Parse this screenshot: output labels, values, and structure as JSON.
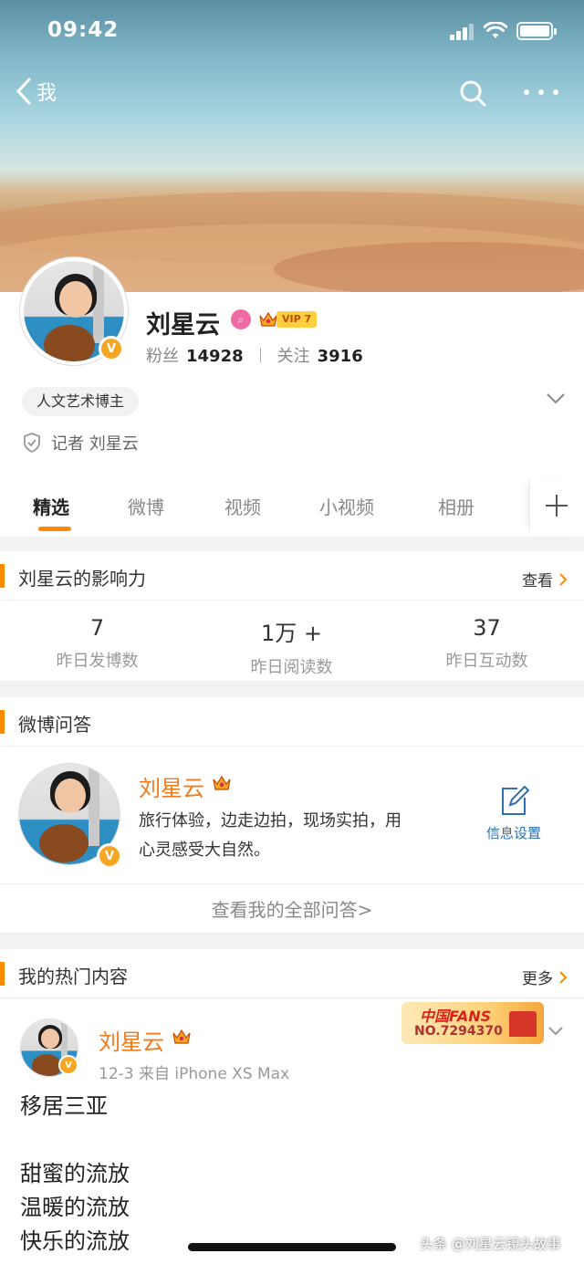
{
  "status_bar": {
    "time": "09:42"
  },
  "nav": {
    "back_label": "我"
  },
  "profile": {
    "name": "刘星云",
    "vip_label": "VIP 7",
    "verified_glyph": "V",
    "followers_label": "粉丝",
    "followers_count": "14928",
    "following_label": "关注",
    "following_count": "3916",
    "tag": "人文艺术博主",
    "reporter": "记者 刘星云"
  },
  "tabs": [
    {
      "label": "精选"
    },
    {
      "label": "微博"
    },
    {
      "label": "视频"
    },
    {
      "label": "小视频"
    },
    {
      "label": "相册"
    }
  ],
  "influence": {
    "title": "刘星云的影响力",
    "more_label": "查看",
    "metrics": [
      {
        "value": "7",
        "label": "昨日发博数"
      },
      {
        "value": "1万 +",
        "label": "昨日阅读数"
      },
      {
        "value": "37",
        "label": "昨日互动数"
      }
    ]
  },
  "qa": {
    "title": "微博问答",
    "name": "刘星云",
    "description": "旅行体验，边走边拍，现场实拍，用心灵感受大自然。",
    "settings_label": "信息设置",
    "view_all": "查看我的全部问答>"
  },
  "hot": {
    "title": "我的热门内容",
    "more_label": "更多",
    "post": {
      "author": "刘星云",
      "meta": "12-3  来自 iPhone XS Max",
      "fans_badge_title": "中国FANS",
      "fans_badge_no": "NO.7294370",
      "lines": [
        "移居三亚",
        "",
        "甜蜜的流放",
        "温暖的流放",
        "快乐的流放"
      ]
    }
  },
  "watermark": "头条 @刘星云镜头故事",
  "colors": {
    "accent": "#ff8a00",
    "name_orange": "#f07b1d",
    "link_blue": "#2f6fb5"
  }
}
